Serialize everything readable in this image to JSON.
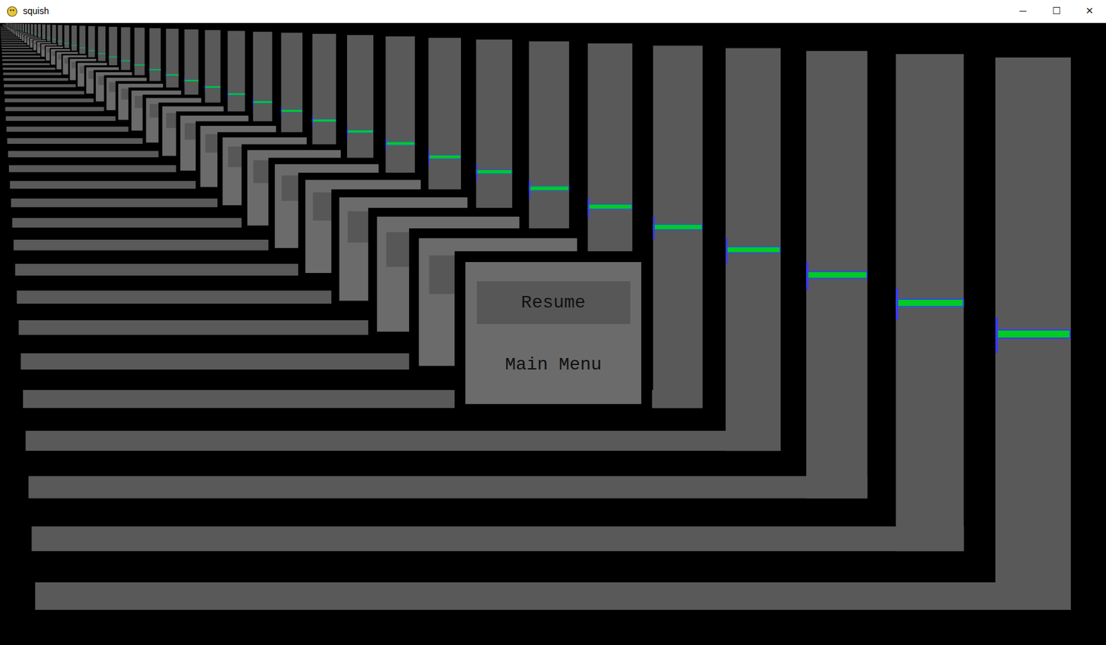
{
  "window": {
    "title": "squish",
    "controls": [
      "─",
      "☐",
      "✕"
    ]
  },
  "game": {
    "player": {
      "level": 0.5
    }
  },
  "pause_menu": {
    "items": [
      {
        "label": "Resume",
        "selected": true
      },
      {
        "label": "Main Menu",
        "selected": false
      }
    ]
  }
}
